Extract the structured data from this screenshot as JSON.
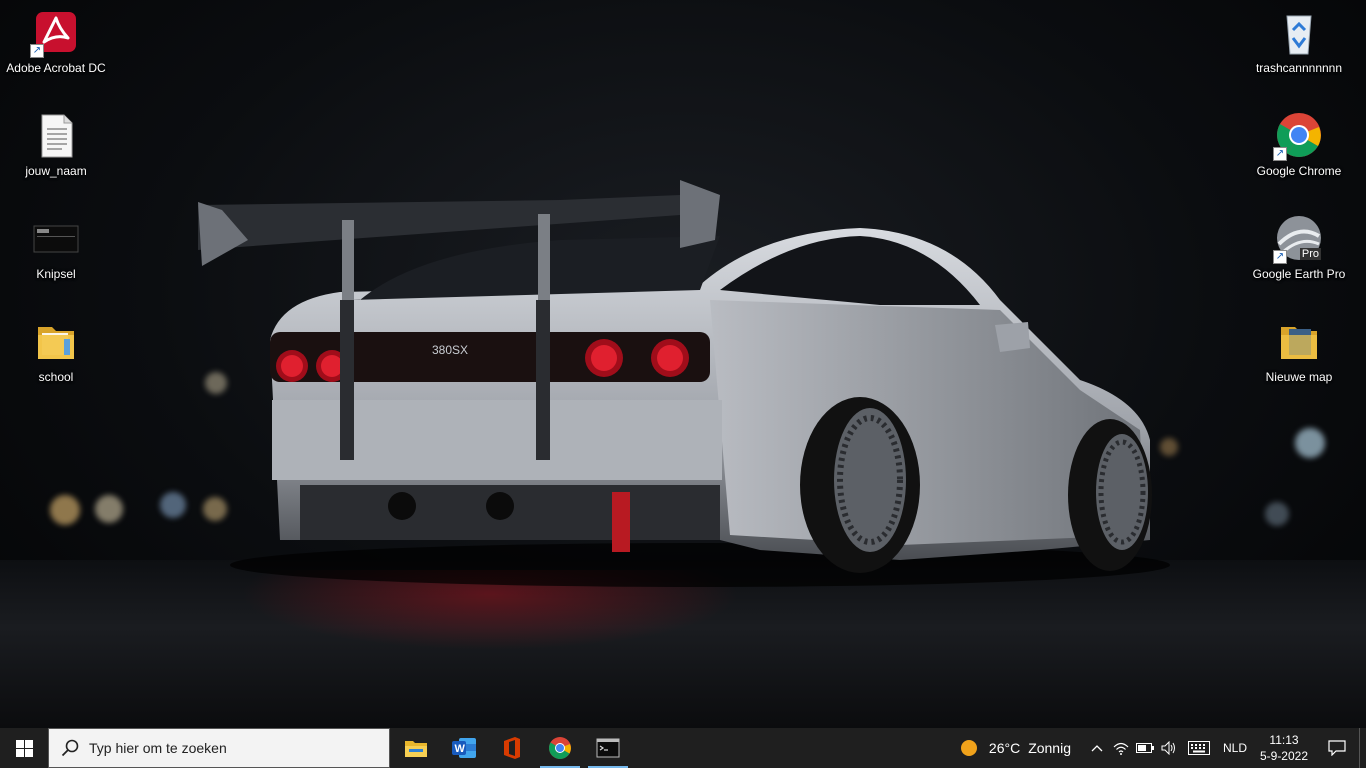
{
  "desktop": {
    "icons_left": [
      {
        "label": "Adobe Acrobat DC",
        "icon": "adobe-acrobat-icon"
      },
      {
        "label": "jouw_naam",
        "icon": "text-document-icon"
      },
      {
        "label": "Knipsel",
        "icon": "screenshot-image-icon"
      },
      {
        "label": "school",
        "icon": "folder-icon"
      }
    ],
    "icons_right": [
      {
        "label": "trashcannnnnnn",
        "icon": "recycle-bin-icon"
      },
      {
        "label": "Google Chrome",
        "icon": "chrome-icon"
      },
      {
        "label": "Google Earth Pro",
        "icon": "google-earth-icon",
        "badge": "Pro"
      },
      {
        "label": "Nieuwe map",
        "icon": "folder-icon"
      }
    ],
    "wallpaper_plate": "380SX"
  },
  "taskbar": {
    "search_placeholder": "Typ hier om te zoeken",
    "apps": [
      {
        "name": "File Explorer",
        "icon": "file-explorer-icon"
      },
      {
        "name": "Word",
        "icon": "word-icon"
      },
      {
        "name": "Office",
        "icon": "office-icon"
      },
      {
        "name": "Google Chrome",
        "icon": "chrome-icon"
      },
      {
        "name": "Command Prompt",
        "icon": "terminal-icon"
      }
    ],
    "weather": {
      "temp": "26°C",
      "condition": "Zonnig"
    },
    "language": "NLD",
    "time": "11:13",
    "date": "5-9-2022"
  },
  "colors": {
    "taskbar": "#1f1f1f",
    "search_bg": "#f3f3f3",
    "accent": "#76b9ed"
  }
}
